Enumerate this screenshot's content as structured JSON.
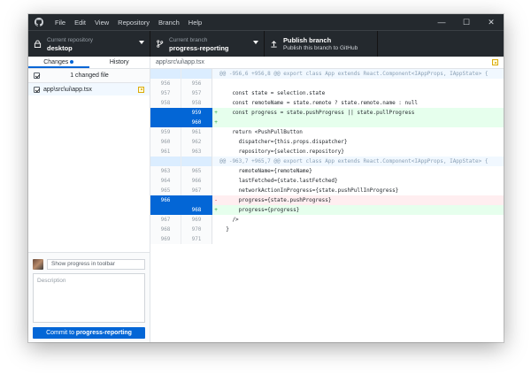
{
  "menu": {
    "items": [
      "File",
      "Edit",
      "View",
      "Repository",
      "Branch",
      "Help"
    ],
    "window_controls": [
      "—",
      "☐",
      "✕"
    ]
  },
  "toolbar": {
    "repository": {
      "label": "Current repository",
      "value": "desktop"
    },
    "branch": {
      "label": "Current branch",
      "value": "progress-reporting"
    },
    "publish": {
      "label": "Publish branch",
      "description": "Publish this branch to GitHub"
    }
  },
  "sidebar": {
    "tabs": [
      {
        "label": "Changes"
      },
      {
        "label": "History"
      }
    ],
    "changed_files_label": "1 changed file",
    "files": [
      {
        "path": "app\\src\\ui\\app.tsx"
      }
    ]
  },
  "commit": {
    "summary_placeholder": "Show progress in toolbar",
    "description_placeholder": "Description",
    "button_prefix": "Commit to",
    "button_branch": "progress-reporting"
  },
  "diff": {
    "file_path": "app\\src\\ui\\app.tsx",
    "lines": [
      {
        "type": "hunk",
        "old": "",
        "new": "",
        "gutter": "",
        "text": "@@ -956,6 +956,8 @@ export class App extends React.Component<IAppProps, IAppState> {"
      },
      {
        "type": "ctx",
        "old": "956",
        "new": "956",
        "gutter": "",
        "text": ""
      },
      {
        "type": "ctx",
        "old": "957",
        "new": "957",
        "gutter": "",
        "text": "    const state = selection.state"
      },
      {
        "type": "ctx",
        "old": "958",
        "new": "958",
        "gutter": "",
        "text": "    const remoteName = state.remote ? state.remote.name : null"
      },
      {
        "type": "add sel",
        "old": "",
        "new": "959",
        "gutter": "+",
        "text": "    const progress = state.pushProgress || state.pullProgress"
      },
      {
        "type": "add sel",
        "old": "",
        "new": "960",
        "gutter": "+",
        "text": ""
      },
      {
        "type": "ctx",
        "old": "959",
        "new": "961",
        "gutter": "",
        "text": "    return <PushPullButton"
      },
      {
        "type": "ctx",
        "old": "960",
        "new": "962",
        "gutter": "",
        "text": "      dispatcher={this.props.dispatcher}"
      },
      {
        "type": "ctx",
        "old": "961",
        "new": "963",
        "gutter": "",
        "text": "      repository={selection.repository}"
      },
      {
        "type": "hunk",
        "old": "",
        "new": "",
        "gutter": "",
        "text": "@@ -963,7 +965,7 @@ export class App extends React.Component<IAppProps, IAppState> {"
      },
      {
        "type": "ctx",
        "old": "963",
        "new": "965",
        "gutter": "",
        "text": "      remoteName={remoteName}"
      },
      {
        "type": "ctx",
        "old": "964",
        "new": "966",
        "gutter": "",
        "text": "      lastFetched={state.lastFetched}"
      },
      {
        "type": "ctx",
        "old": "965",
        "new": "967",
        "gutter": "",
        "text": "      networkActionInProgress={state.pushPullInProgress}"
      },
      {
        "type": "del sel",
        "old": "966",
        "new": "",
        "gutter": "-",
        "text": "      progress={state.pushProgress}"
      },
      {
        "type": "add sel",
        "old": "",
        "new": "968",
        "gutter": "+",
        "text": "      progress={progress}"
      },
      {
        "type": "ctx",
        "old": "967",
        "new": "969",
        "gutter": "",
        "text": "    />"
      },
      {
        "type": "ctx",
        "old": "968",
        "new": "970",
        "gutter": "",
        "text": "  }"
      },
      {
        "type": "ctx",
        "old": "969",
        "new": "971",
        "gutter": "",
        "text": ""
      }
    ]
  }
}
